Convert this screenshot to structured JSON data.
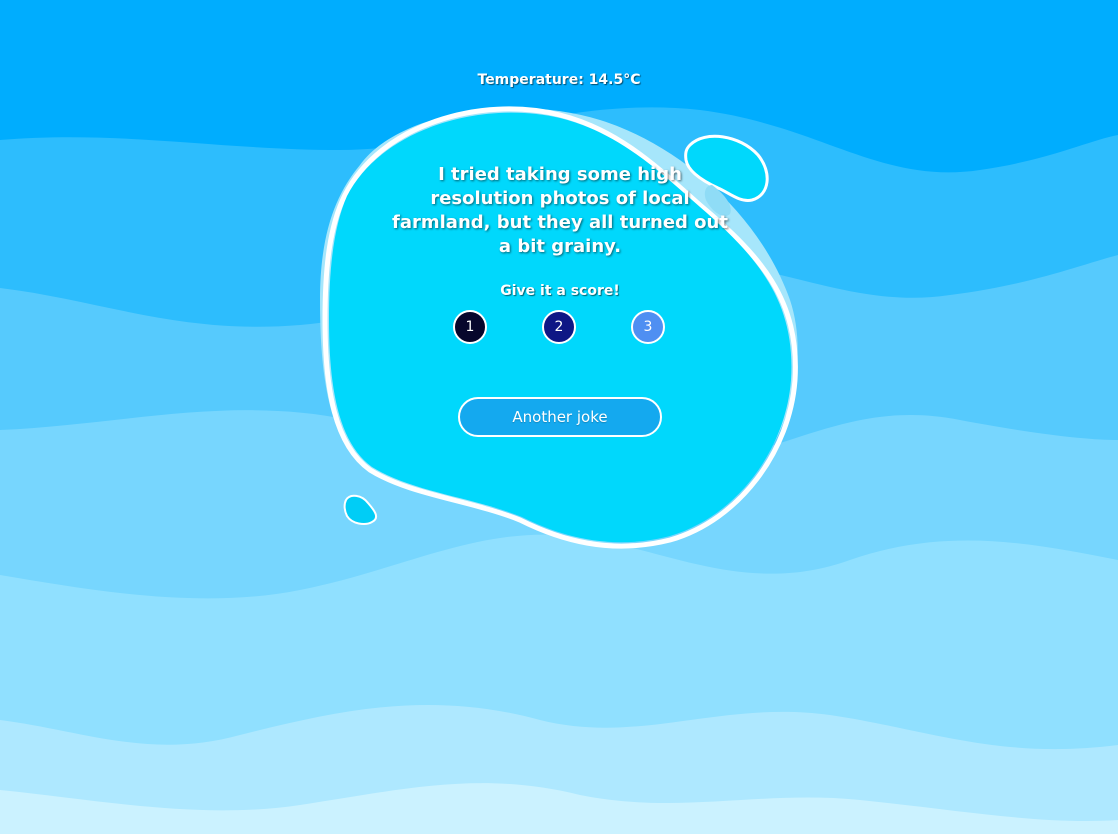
{
  "temperature": "Temperature: 14.5°C",
  "joke": {
    "text": "I tried taking some high resolution photos of local farmland, but they all turned out a bit grainy."
  },
  "score_prompt": "Give it a score!",
  "scores": [
    {
      "label": "1",
      "color": "#07072c"
    },
    {
      "label": "2",
      "color": "#0f1785"
    },
    {
      "label": "3",
      "color": "#4f8ff2"
    }
  ],
  "another_button": "Another joke",
  "colors": {
    "sky": "#00adfe",
    "blob": "#00d8fc",
    "button": "#14a9ef"
  }
}
